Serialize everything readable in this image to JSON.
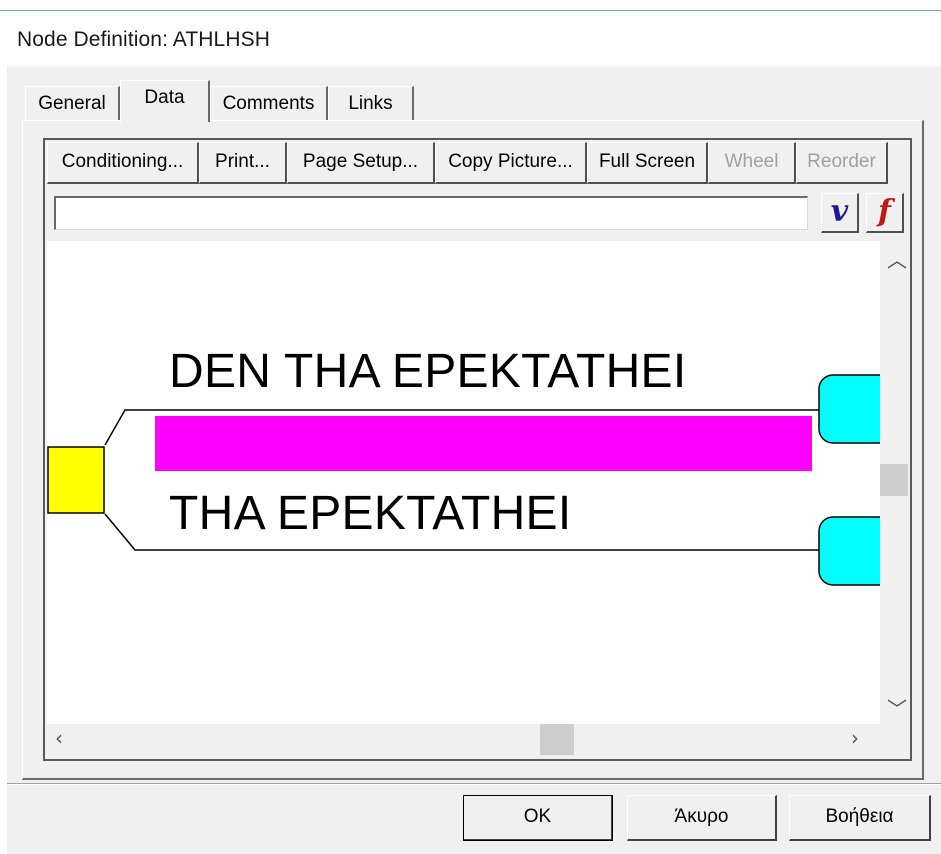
{
  "window": {
    "title": "Node Definition: ATHLHSH"
  },
  "tabs": [
    {
      "label": "General",
      "active": false
    },
    {
      "label": "Data",
      "active": true
    },
    {
      "label": "Comments",
      "active": false
    },
    {
      "label": "Links",
      "active": false
    }
  ],
  "toolbar": {
    "buttons": [
      {
        "label": "Conditioning...",
        "enabled": true
      },
      {
        "label": "Print...",
        "enabled": true
      },
      {
        "label": "Page Setup...",
        "enabled": true
      },
      {
        "label": "Copy Picture...",
        "enabled": true
      },
      {
        "label": "Full Screen",
        "enabled": true
      },
      {
        "label": "Wheel",
        "enabled": false
      },
      {
        "label": "Reorder",
        "enabled": false
      }
    ],
    "formula_value": "",
    "variable_button": "v",
    "function_button": "f"
  },
  "diagram": {
    "branches": [
      {
        "label": "DEN THA EPEKTATHEI"
      },
      {
        "label": "THA EPEKTATHEI"
      }
    ],
    "colors": {
      "chance_node": "#ffff00",
      "terminal_node": "#00ffff",
      "highlight_bar": "#ff00ff",
      "line": "#000000"
    }
  },
  "footer": {
    "ok_label": "OK",
    "cancel_label": "Άκυρο",
    "help_label": "Βοήθεια"
  },
  "colors": {
    "dialog_bg": "#f0f0f0",
    "canvas_bg": "#ffffff",
    "disabled_text": "#a0a0a0",
    "v_icon": "#1a1aa0",
    "f_icon": "#c01818"
  }
}
